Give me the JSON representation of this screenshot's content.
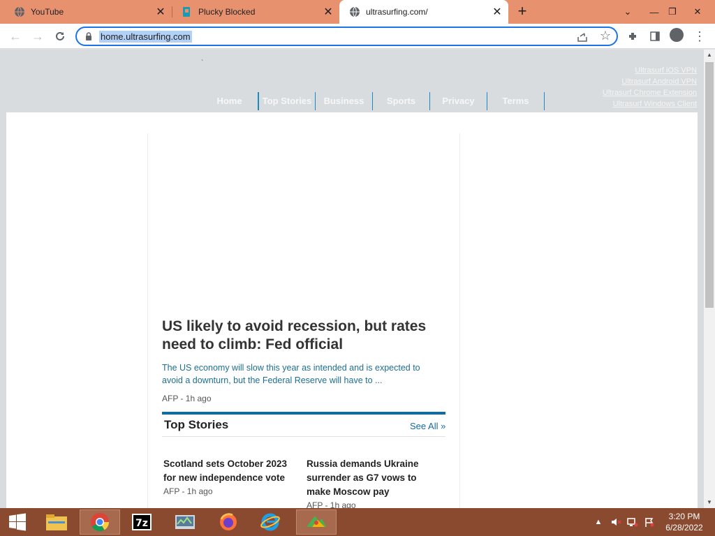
{
  "browser": {
    "tabs": [
      {
        "title": "YouTube",
        "icon": "globe-icon"
      },
      {
        "title": "Plucky Blocked",
        "icon": "plucky-icon"
      },
      {
        "title": "ultrasurfing.com/",
        "icon": "globe-icon"
      }
    ],
    "address": "home.ultrasurfing.com"
  },
  "page": {
    "tick_mark": "`",
    "side_links": [
      "Ultrasurf iOS VPN",
      "Ultrasurf Android VPN",
      "Ultrasurf Chrome Extension",
      "Ultrasurf Windows Client"
    ],
    "nav": [
      "Home",
      "Top Stories",
      "Business",
      "Sports",
      "Privacy",
      "Terms"
    ],
    "lead": {
      "headline": "US likely to avoid recession, but rates need to climb: Fed official",
      "summary": "The US economy will slow this year as intended and is expected to avoid a downturn, but the Federal Reserve will have to ...",
      "meta": "AFP - 1h ago"
    },
    "top_stories": {
      "title": "Top Stories",
      "see_all": "See All »",
      "items": [
        {
          "title": "Scotland sets October 2023 for new independence vote",
          "meta": "AFP - 1h ago"
        },
        {
          "title": "Russia demands Ukraine surrender as G7 vows to make Moscow pay",
          "meta": "AFP - 1h ago"
        }
      ]
    }
  },
  "taskbar": {
    "apps": [
      "start-button",
      "file-explorer",
      "chrome",
      "7zip",
      "task-manager",
      "firefox",
      "internet-explorer",
      "app"
    ],
    "clock_time": "3:20 PM",
    "clock_date": "6/28/2022"
  },
  "colors": {
    "tabstrip": "#e8916f",
    "taskbar": "#8a4a2f",
    "accent": "#146ba0",
    "summary_text": "#1e6e92"
  }
}
